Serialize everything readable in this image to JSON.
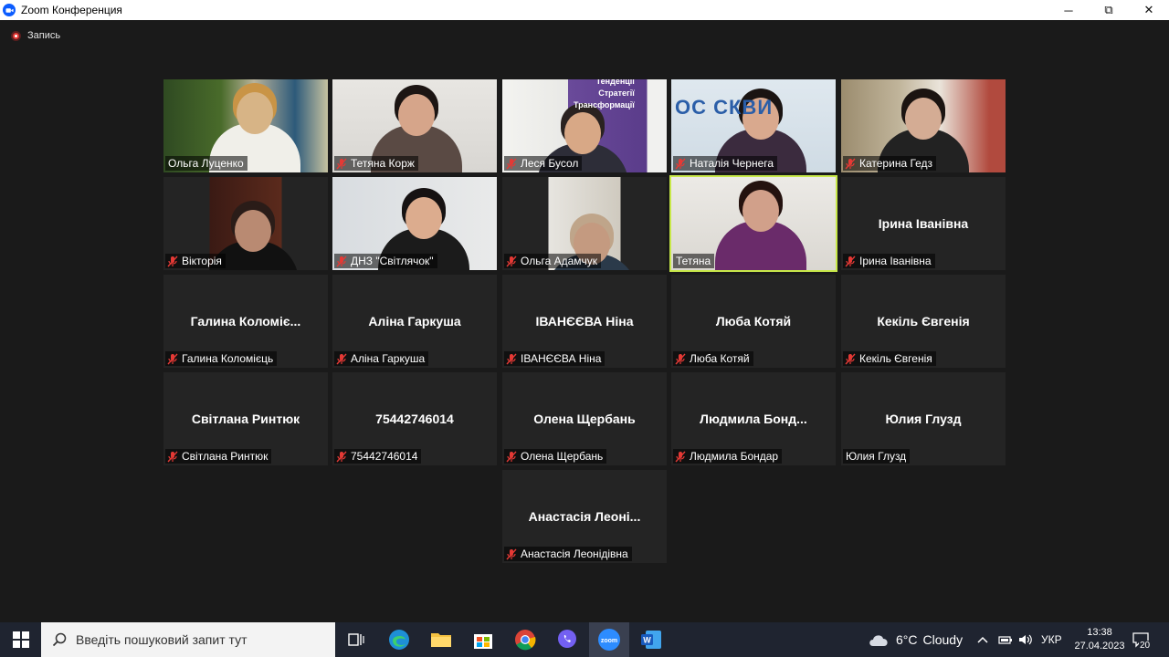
{
  "window": {
    "title": "Zoom Конференция",
    "minimize": "─",
    "maximize": "⧉",
    "close": "✕"
  },
  "recording": {
    "label": "Запись"
  },
  "colors": {
    "speaking_border": "#c8e84a",
    "mic_muted": "#e53935"
  },
  "participants": [
    {
      "name": "Ольга Луценко",
      "display": "",
      "video": true,
      "muted": false
    },
    {
      "name": "Тетяна Корж",
      "display": "",
      "video": true,
      "muted": true
    },
    {
      "name": "Леся Бусол",
      "display": "",
      "video": true,
      "muted": true,
      "backdrop_text": "Тенденції\nСтратегії\nТрансформації"
    },
    {
      "name": "Наталія Чернега",
      "display": "",
      "video": true,
      "muted": true,
      "backdrop_text": "ОС СКВИ"
    },
    {
      "name": "Катерина Гедз",
      "display": "",
      "video": true,
      "muted": true
    },
    {
      "name": "Вікторія",
      "display": "",
      "video": true,
      "muted": true
    },
    {
      "name": "ДНЗ \"Світлячок\"",
      "display": "",
      "video": true,
      "muted": true
    },
    {
      "name": "Ольга Адамчук",
      "display": "",
      "video": true,
      "muted": true
    },
    {
      "name": "Тетяна",
      "display": "",
      "video": true,
      "muted": false,
      "speaking": true
    },
    {
      "name": "Ірина Іванівна",
      "display": "Ірина Іванівна",
      "video": false,
      "muted": true
    },
    {
      "name": "Галина Коломієць",
      "display": "Галина  Коломіє...",
      "video": false,
      "muted": true
    },
    {
      "name": "Аліна Гаркуша",
      "display": "Аліна Гаркуша",
      "video": false,
      "muted": true
    },
    {
      "name": "ІВАНЄЄВА Ніна",
      "display": "ІВАНЄЄВА Ніна",
      "video": false,
      "muted": true
    },
    {
      "name": "Люба Котяй",
      "display": "Люба Котяй",
      "video": false,
      "muted": true
    },
    {
      "name": "Кекіль Євгенія",
      "display": "Кекіль Євгенія",
      "video": false,
      "muted": true
    },
    {
      "name": "Світлана Ринтюк",
      "display": "Світлана Ринтюк",
      "video": false,
      "muted": true
    },
    {
      "name": "75442746014",
      "display": "75442746014",
      "video": false,
      "muted": true
    },
    {
      "name": "Олена Щербань",
      "display": "Олена Щербань",
      "video": false,
      "muted": true
    },
    {
      "name": "Людмила Бондар",
      "display": "Людмила  Бонд...",
      "video": false,
      "muted": true
    },
    {
      "name": "Юлия Глузд",
      "display": "Юлия Глузд",
      "video": false,
      "muted": false
    },
    {
      "name": "Анастасія Леонідівна",
      "display": "Анастасія  Леоні...",
      "video": false,
      "muted": true
    }
  ],
  "taskbar": {
    "search_placeholder": "Введіть пошуковий запит тут",
    "apps": [
      "start-icon",
      "task-view-icon",
      "edge-icon",
      "file-explorer-icon",
      "store-icon",
      "chrome-icon",
      "viber-icon",
      "zoom-icon",
      "word-icon"
    ],
    "weather": {
      "temp": "6°C",
      "condition": "Cloudy"
    },
    "language": "УКР",
    "time": "13:38",
    "date": "27.04.2023",
    "notifications": "20"
  }
}
